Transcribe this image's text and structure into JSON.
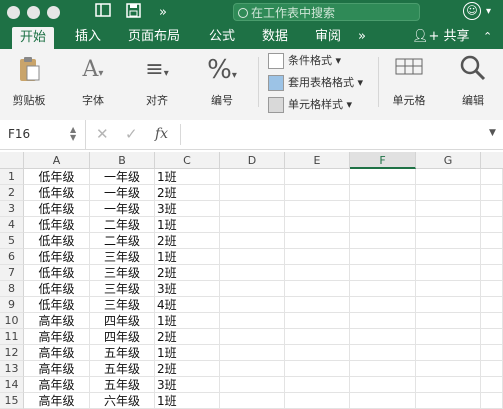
{
  "titlebar": {
    "search_placeholder": "在工作表中搜索"
  },
  "tabs": [
    {
      "label": "开始",
      "active": true
    },
    {
      "label": "插入",
      "active": false
    },
    {
      "label": "页面布局",
      "active": false
    },
    {
      "label": "公式",
      "active": false
    },
    {
      "label": "数据",
      "active": false
    },
    {
      "label": "审阅",
      "active": false
    }
  ],
  "tab_more": "»",
  "share_label": "共享",
  "ribbon": {
    "paste": "剪贴板",
    "font": "字体",
    "align": "对齐",
    "number": "编号",
    "cond_format": "条件格式",
    "table_format": "套用表格格式",
    "cell_style": "单元格样式",
    "cells": "单元格",
    "edit": "编辑"
  },
  "formula_bar": {
    "name_box": "F16",
    "fx": "fx",
    "value": ""
  },
  "columns": [
    "A",
    "B",
    "C",
    "D",
    "E",
    "F",
    "G"
  ],
  "selected_column": "F",
  "rows": [
    {
      "n": "1",
      "a": "低年级",
      "b": "一年级",
      "c": "1班"
    },
    {
      "n": "2",
      "a": "低年级",
      "b": "一年级",
      "c": "2班"
    },
    {
      "n": "3",
      "a": "低年级",
      "b": "一年级",
      "c": "3班"
    },
    {
      "n": "4",
      "a": "低年级",
      "b": "二年级",
      "c": "1班"
    },
    {
      "n": "5",
      "a": "低年级",
      "b": "二年级",
      "c": "2班"
    },
    {
      "n": "6",
      "a": "低年级",
      "b": "三年级",
      "c": "1班"
    },
    {
      "n": "7",
      "a": "低年级",
      "b": "三年级",
      "c": "2班"
    },
    {
      "n": "8",
      "a": "低年级",
      "b": "三年级",
      "c": "3班"
    },
    {
      "n": "9",
      "a": "低年级",
      "b": "三年级",
      "c": "4班"
    },
    {
      "n": "10",
      "a": "高年级",
      "b": "四年级",
      "c": "1班"
    },
    {
      "n": "11",
      "a": "高年级",
      "b": "四年级",
      "c": "2班"
    },
    {
      "n": "12",
      "a": "高年级",
      "b": "五年级",
      "c": "1班"
    },
    {
      "n": "13",
      "a": "高年级",
      "b": "五年级",
      "c": "2班"
    },
    {
      "n": "14",
      "a": "高年级",
      "b": "五年级",
      "c": "3班"
    },
    {
      "n": "15",
      "a": "高年级",
      "b": "六年级",
      "c": "1班"
    }
  ]
}
